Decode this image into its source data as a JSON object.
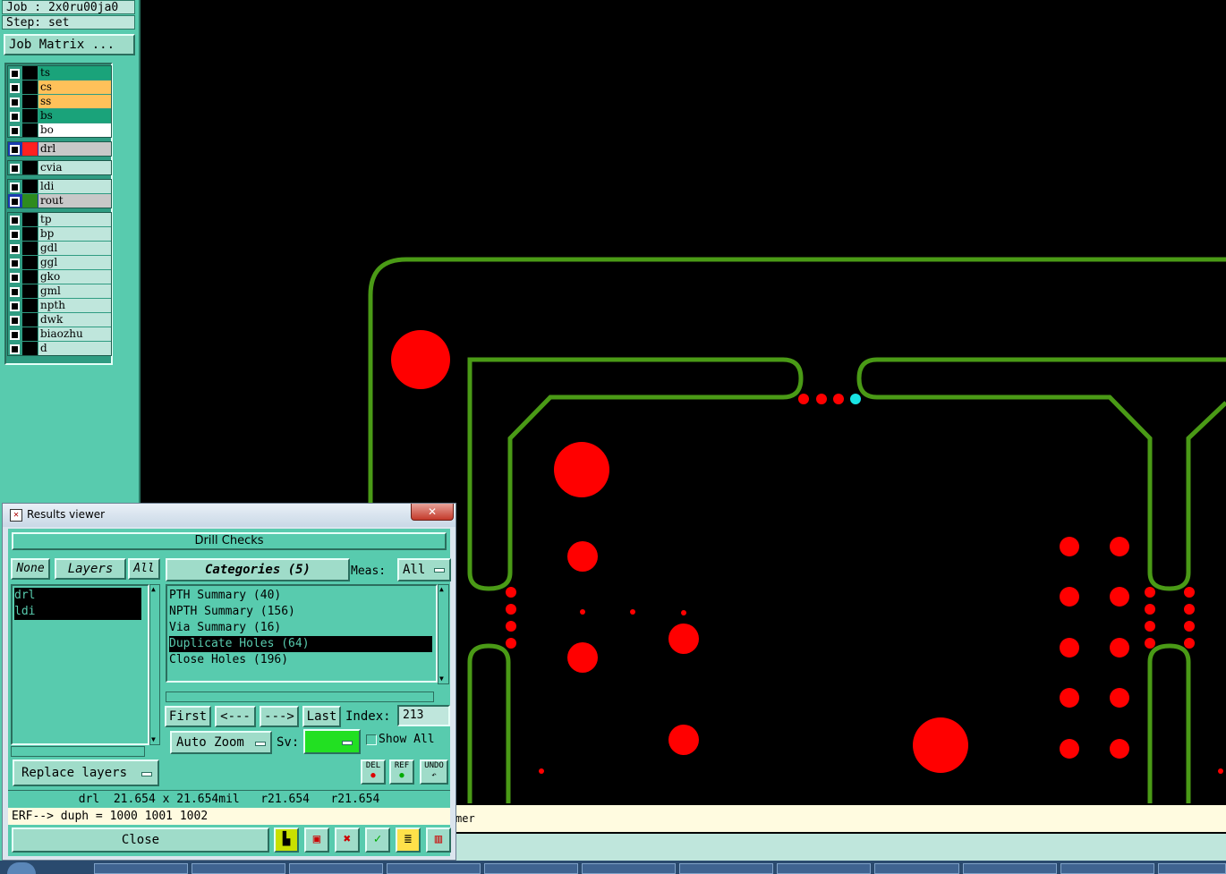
{
  "job": {
    "job_line": "Job : 2x0ru00ja0",
    "step_line": "Step: set",
    "matrix_button": "Job Matrix ..."
  },
  "layers": [
    {
      "name": "ts",
      "color": "#1aa37a"
    },
    {
      "name": "cs",
      "color": "#ffc15a"
    },
    {
      "name": "ss",
      "color": "#ffc15a"
    },
    {
      "name": "bs",
      "color": "#1aa37a"
    },
    {
      "name": "bo",
      "color": "#ffffff"
    },
    {
      "name": "drl",
      "color": "#c8c8c8",
      "swatch": "#ff2020"
    },
    {
      "name": "cvia",
      "color": "#bfe6dc"
    },
    {
      "name": "ldi",
      "color": "#bfe6dc"
    },
    {
      "name": "rout",
      "color": "#c8c8c8",
      "swatch": "#2e8b1e"
    },
    {
      "name": "tp",
      "color": "#bfe6dc"
    },
    {
      "name": "bp",
      "color": "#bfe6dc"
    },
    {
      "name": "gdl",
      "color": "#bfe6dc"
    },
    {
      "name": "ggl",
      "color": "#bfe6dc"
    },
    {
      "name": "gko",
      "color": "#bfe6dc"
    },
    {
      "name": "gml",
      "color": "#bfe6dc"
    },
    {
      "name": "npth",
      "color": "#bfe6dc"
    },
    {
      "name": "dwk",
      "color": "#bfe6dc"
    },
    {
      "name": "biaozhu",
      "color": "#bfe6dc"
    },
    {
      "name": "d",
      "color": "#bfe6dc"
    }
  ],
  "dialog": {
    "title": "Results viewer",
    "close_x": "✕",
    "header": "Drill Checks",
    "none_btn": "None",
    "layers_btn": "Layers",
    "all_btn": "All",
    "categories_btn": "Categories (5)",
    "meas_label": "Meas:",
    "meas_value": "All",
    "layer_items": [
      "drl",
      "ldi"
    ],
    "categories": [
      {
        "label": "PTH Summary (40)",
        "selected": false
      },
      {
        "label": "NPTH Summary (156)",
        "selected": false
      },
      {
        "label": "Via Summary (16)",
        "selected": false
      },
      {
        "label": "Duplicate Holes (64)",
        "selected": true
      },
      {
        "label": "Close Holes (196)",
        "selected": false
      }
    ],
    "first_btn": "First",
    "prev_btn": "<---",
    "next_btn": "--->",
    "last_btn": "Last",
    "index_label": "Index:",
    "index_value": "213",
    "auto_zoom": "Auto Zoom",
    "sv_label": "Sv:",
    "show_all": "Show All",
    "del_btn": "DEL",
    "ref_btn": "REF",
    "undo_btn": "UNDO",
    "replace_layers": "Replace layers",
    "status_line": "drl  21.654 x 21.654mil   r21.654   r21.654",
    "erf_line": "ERF--> duph = 1000 1001 1002",
    "close_btn": "Close"
  },
  "message_bar": {
    "text": "mer"
  },
  "colors": {
    "panel": "#58cbae",
    "outline": "#4a9a16",
    "hole": "#ff0000",
    "highlight": "#18e4e4"
  }
}
